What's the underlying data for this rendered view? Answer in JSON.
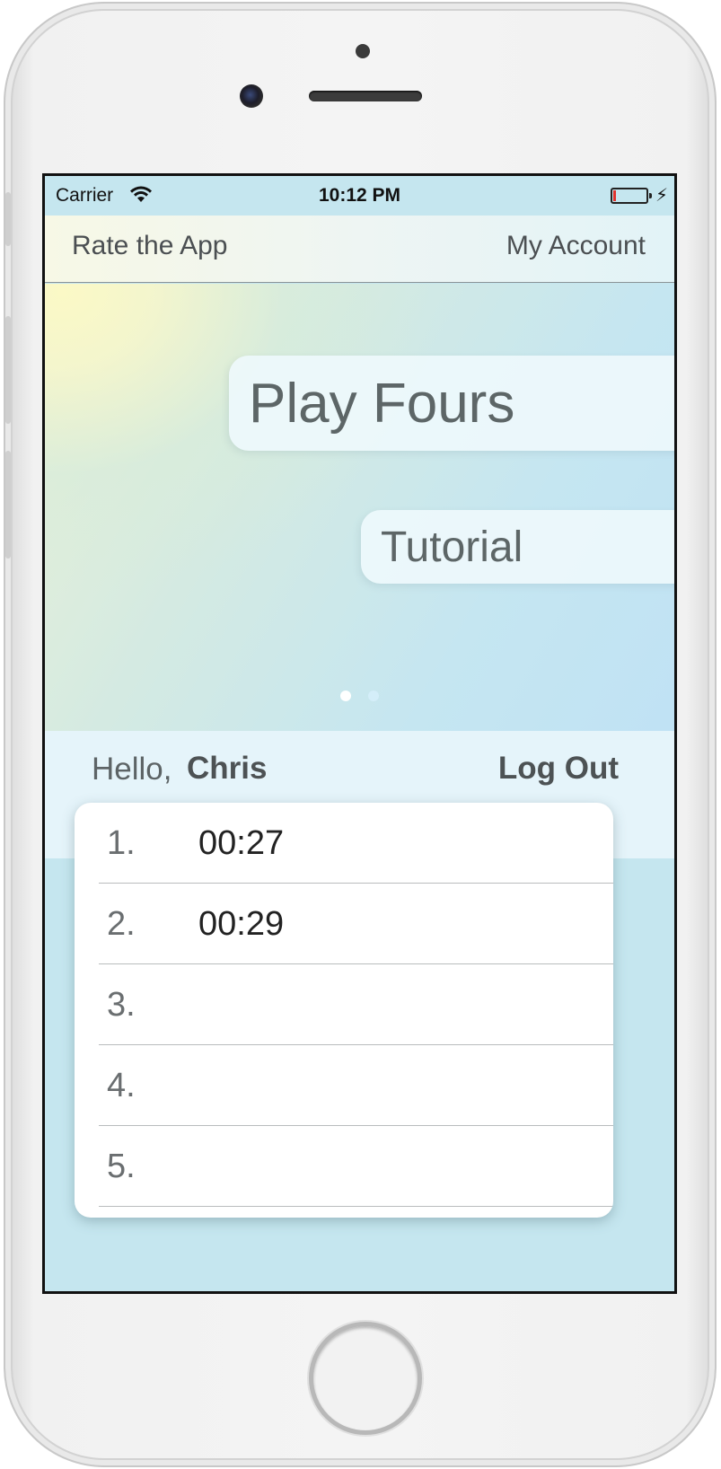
{
  "status_bar": {
    "carrier": "Carrier",
    "time": "10:12 PM",
    "wifi_icon": "wifi-icon",
    "battery_icon": "battery-low-icon",
    "charge_icon": "charging-bolt-icon"
  },
  "nav": {
    "left_label": "Rate the App",
    "right_label": "My Account"
  },
  "menu": {
    "play_label": "Play Fours",
    "tutorial_label": "Tutorial"
  },
  "pager": {
    "page_count": 2,
    "active_index": 0
  },
  "user": {
    "greeting": "Hello,",
    "name": "Chris",
    "logout_label": "Log Out"
  },
  "scores": [
    {
      "rank": "1.",
      "time": "00:27"
    },
    {
      "rank": "2.",
      "time": "00:29"
    },
    {
      "rank": "3.",
      "time": ""
    },
    {
      "rank": "4.",
      "time": ""
    },
    {
      "rank": "5.",
      "time": ""
    }
  ],
  "colors": {
    "text_gray": "#4b4f52",
    "status_red": "#e0332e",
    "card_bg": "#ffffff",
    "band_bg": "#e5f4fa"
  }
}
